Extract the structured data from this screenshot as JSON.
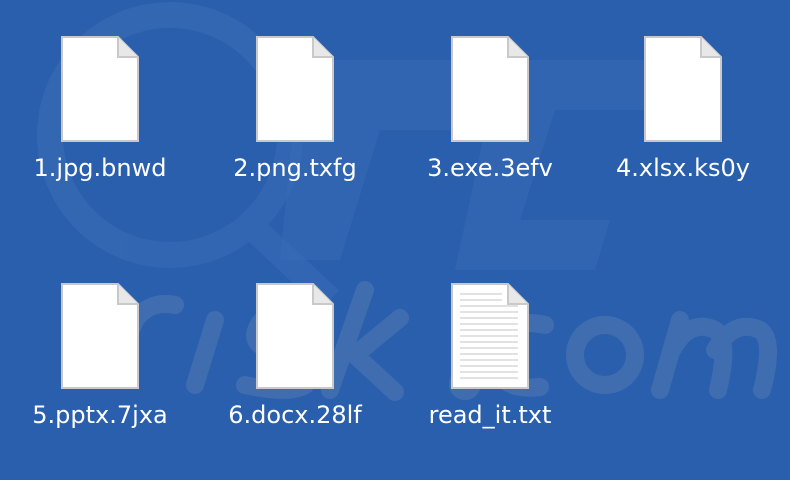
{
  "desktop": {
    "background_color": "#2a5fad",
    "watermark_text": "PC risk.com",
    "files": [
      {
        "name": "1.jpg.bnwd",
        "icon": "blank-document-icon"
      },
      {
        "name": "2.png.txfg",
        "icon": "blank-document-icon"
      },
      {
        "name": "3.exe.3efv",
        "icon": "blank-document-icon"
      },
      {
        "name": "4.xlsx.ks0y",
        "icon": "blank-document-icon"
      },
      {
        "name": "5.pptx.7jxa",
        "icon": "blank-document-icon"
      },
      {
        "name": "6.docx.28lf",
        "icon": "blank-document-icon"
      },
      {
        "name": "read_it.txt",
        "icon": "text-document-icon"
      }
    ]
  }
}
